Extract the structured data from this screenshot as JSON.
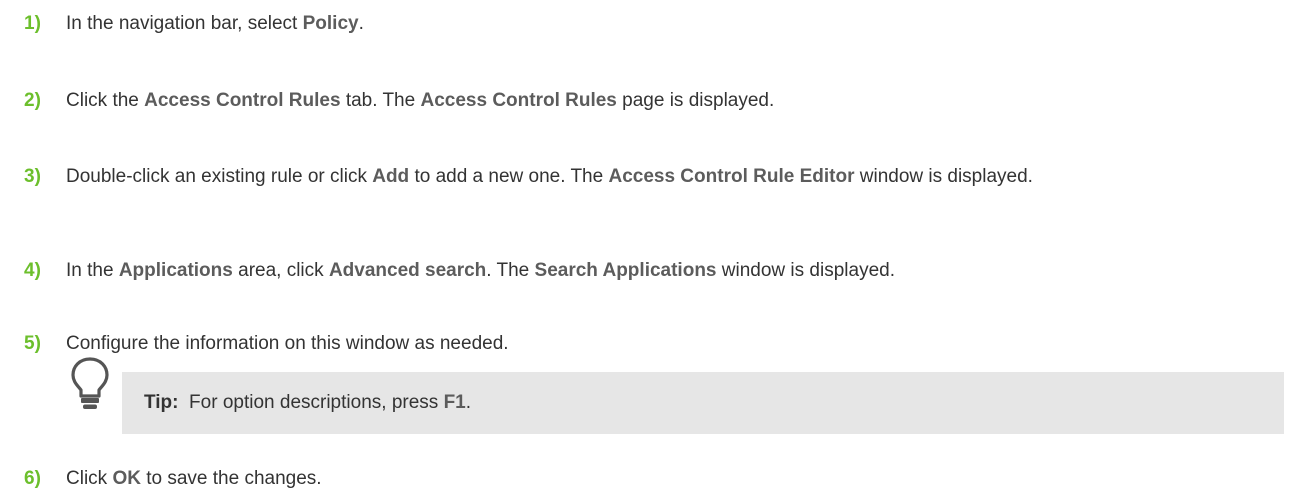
{
  "steps": [
    {
      "num": "1)",
      "parts": [
        "In the navigation bar, select ",
        "Policy",
        "."
      ]
    },
    {
      "num": "2)",
      "parts": [
        "Click the ",
        "Access Control Rules",
        " tab. The ",
        "Access Control Rules",
        " page is displayed."
      ]
    },
    {
      "num": "3)",
      "parts": [
        "Double-click an existing rule or click ",
        "Add",
        " to add a new one. The ",
        "Access Control Rule Editor",
        " window is displayed."
      ]
    },
    {
      "num": "4)",
      "parts": [
        "In the ",
        "Applications",
        " area, click ",
        "Advanced search",
        ". The ",
        "Search Applications",
        " window is displayed."
      ]
    },
    {
      "num": "5)",
      "parts": [
        "Configure the information on this window as needed."
      ]
    },
    {
      "num": "6)",
      "parts": [
        "Click ",
        "OK",
        " to save the changes."
      ]
    }
  ],
  "tip": {
    "label": "Tip:",
    "parts": [
      "For option descriptions, press ",
      "F1",
      "."
    ],
    "icon": "lightbulb-icon"
  },
  "colors": {
    "step_number": "#6cbf2c",
    "ui_term": "#5c5c5c",
    "text": "#333333",
    "tip_background": "#e6e6e6"
  }
}
